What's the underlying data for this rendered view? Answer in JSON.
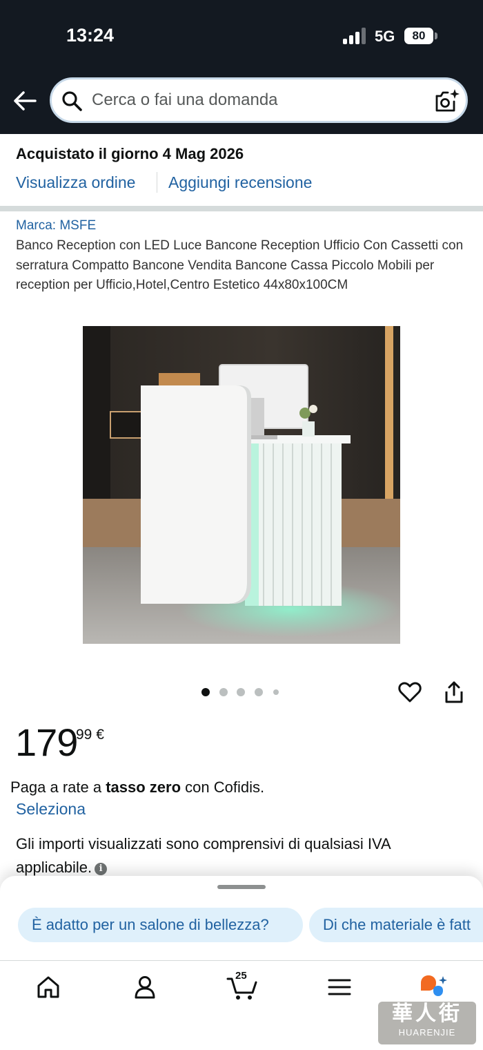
{
  "status_bar": {
    "time": "13:24",
    "network": "5G",
    "battery": "80"
  },
  "search": {
    "placeholder": "Cerca o fai una domanda"
  },
  "order": {
    "purchased": "Acquistato il giorno 4 Mag 2026",
    "view_order": "Visualizza ordine",
    "add_review": "Aggiungi recensione"
  },
  "product": {
    "brand": "Marca: MSFE",
    "title": "Banco Reception con LED Luce Bancone Reception Ufficio Con Cassetti con serratura Compatto Bancone Vendita Bancone Cassa Piccolo Mobili per reception per Ufficio,Hotel,Centro Estetico 44x80x100CM",
    "image_count": 5,
    "current_image": 1,
    "price_integer": "179",
    "price_decimal": "99 €",
    "installments_prefix": "Paga a rate a ",
    "installments_bold": "tasso zero",
    "installments_suffix": " con Cofidis.",
    "select_link": "Seleziona",
    "vat_note": "Gli importi visualizzati sono comprensivi di qualsiasi IVA applicabile."
  },
  "suggestions": {
    "chips": [
      "È adatto per un salone di bellezza?",
      "Di che materiale è fatt"
    ]
  },
  "nav": {
    "cart_count": "25"
  },
  "watermark": {
    "main": "華人街",
    "sub": "HUARENJIE"
  },
  "colors": {
    "header_bg": "#131921",
    "link": "#2162a1",
    "chip_bg": "#dff0fb"
  }
}
